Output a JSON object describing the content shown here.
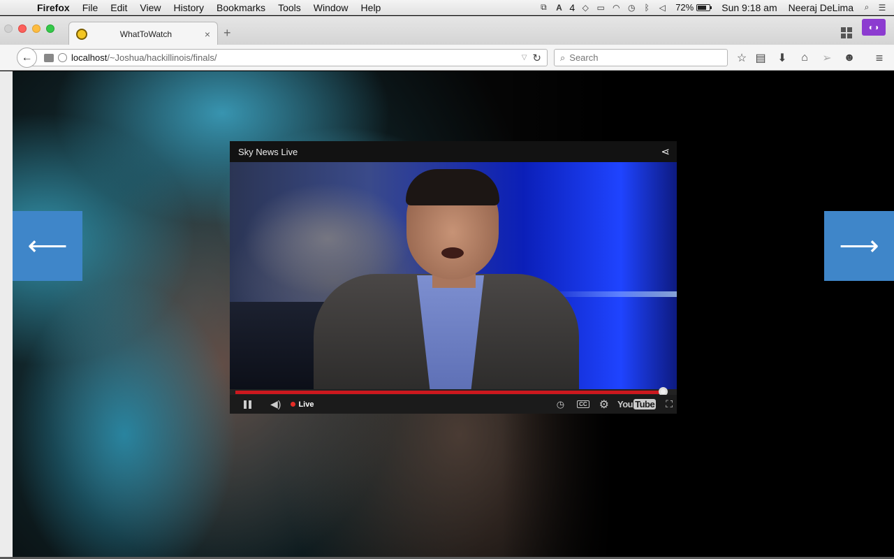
{
  "menubar": {
    "app_name": "Firefox",
    "items": [
      "File",
      "Edit",
      "View",
      "History",
      "Bookmarks",
      "Tools",
      "Window",
      "Help"
    ],
    "status_count": "4",
    "battery_percent": "72%",
    "battery_level": 0.72,
    "clock": "Sun 9:18 am",
    "user": "Neeraj DeLima"
  },
  "tab": {
    "title": "WhatToWatch",
    "close_glyph": "×",
    "new_tab_glyph": "+"
  },
  "navbar": {
    "url_host": "localhost",
    "url_path": "/~Joshua/hackillinois/finals/",
    "search_placeholder": "Search"
  },
  "page": {
    "prev_arrow": "⟵",
    "next_arrow": "⟶"
  },
  "player": {
    "title": "Sky News Live",
    "live_label": "Live",
    "youtube_logo": "You",
    "youtube_logo_tube": "Tube",
    "cc_label": "CC",
    "progress": 0.98
  },
  "colors": {
    "nav_button": "#3f86c9",
    "progress": "#cc181e",
    "private_browsing": "#8c3bd0"
  }
}
